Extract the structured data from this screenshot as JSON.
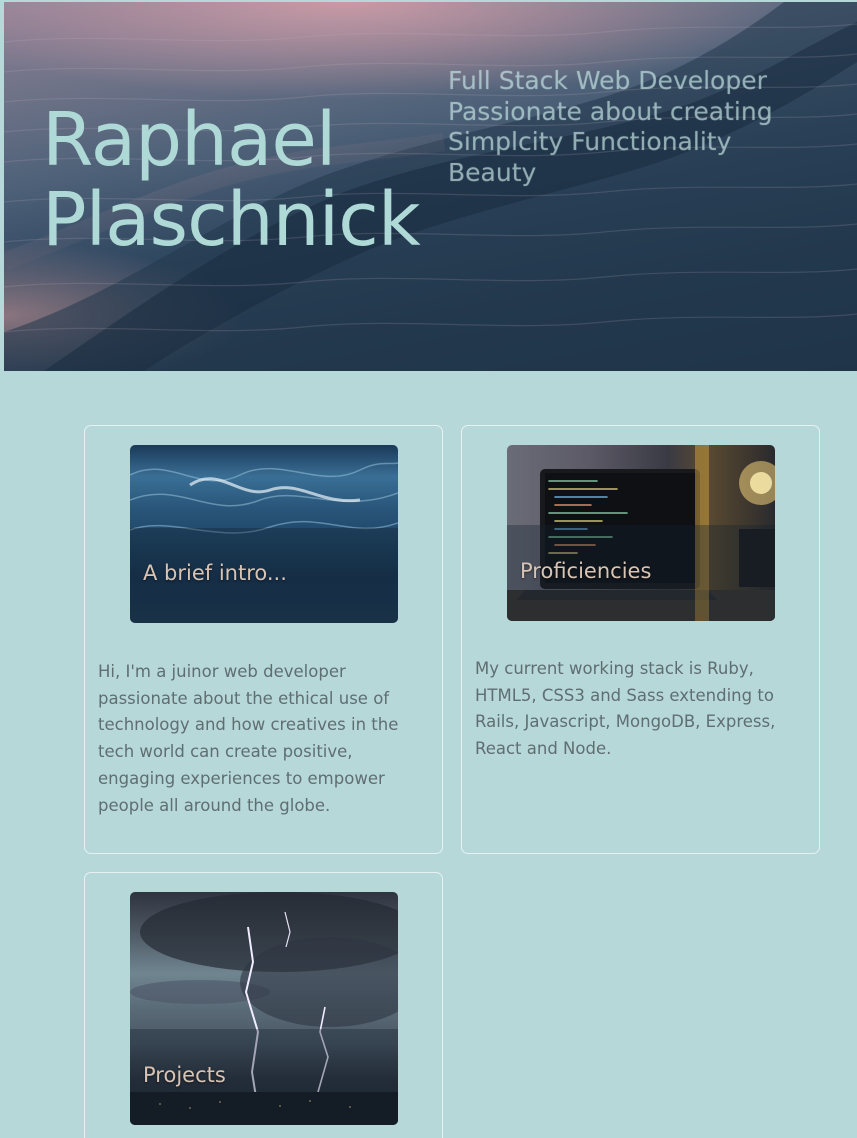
{
  "hero": {
    "name_line1": "Raphael",
    "name_line2": "Plaschnick",
    "tagline": [
      "Full Stack Web Developer",
      "Passionate about creating",
      "Simplcity Functionality",
      "Beauty"
    ]
  },
  "cards": [
    {
      "title": "A brief intro...",
      "text": "Hi, I'm a juinor web developer passionate about the ethical use of technology and how creatives in the tech world can create positive, engaging experiences to empower people all around the globe."
    },
    {
      "title": "Proficiencies",
      "text": "My current working stack is Ruby, HTML5, CSS3 and Sass extending to Rails, Javascript, MongoDB, Express, React and Node."
    },
    {
      "title": "Projects",
      "text": ""
    }
  ],
  "colors": {
    "page_background": "#b7d8d9",
    "name_color": "#aed9d6",
    "card_title_color": "#d8c4b4",
    "body_text_color": "#5f6e71"
  }
}
